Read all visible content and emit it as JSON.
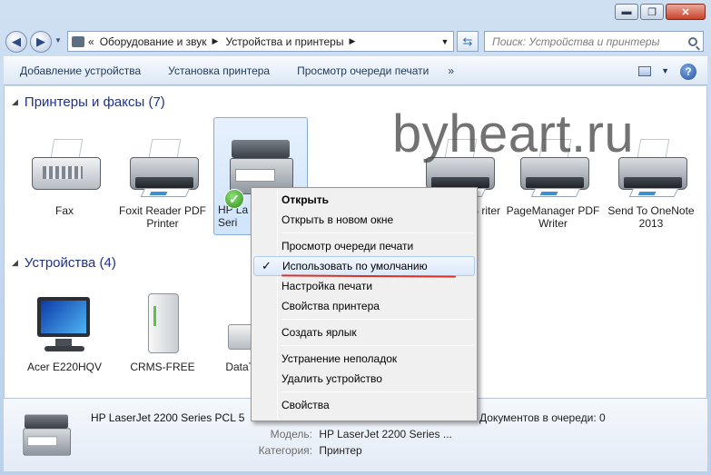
{
  "window": {
    "minimize": "▬",
    "maximize": "❐",
    "close": "✕"
  },
  "address": {
    "overflow": "«",
    "segments": [
      "Оборудование и звук",
      "Устройства и принтеры"
    ],
    "search_placeholder": "Поиск: Устройства и принтеры"
  },
  "toolbar": {
    "items": [
      "Добавление устройства",
      "Установка принтера",
      "Просмотр очереди печати"
    ],
    "more": "»"
  },
  "printers_group": {
    "title": "Принтеры и факсы (7)",
    "devices": [
      {
        "label": "Fax"
      },
      {
        "label": "Foxit Reader PDF Printer"
      },
      {
        "label": "HP La Seri"
      },
      {
        "label": "PS riter"
      },
      {
        "label": "PageManager PDF Writer"
      },
      {
        "label": "Send To OneNote 2013"
      }
    ]
  },
  "devices_group": {
    "title": "Устройства (4)",
    "devices": [
      {
        "label": "Acer E220HQV"
      },
      {
        "label": "CRMS-FREE"
      },
      {
        "label": "DataT"
      }
    ]
  },
  "context_menu": {
    "items": [
      {
        "label": "Открыть",
        "bold": true
      },
      {
        "label": "Открыть в новом окне"
      },
      {
        "label": "Просмотр очереди печати"
      },
      {
        "label": "Использовать по умолчанию",
        "checked": true
      },
      {
        "label": "Настройка печати"
      },
      {
        "label": "Свойства принтера"
      },
      {
        "label": "Создать ярлык"
      },
      {
        "label": "Устранение неполадок"
      },
      {
        "label": "Удалить устройство"
      },
      {
        "label": "Свойства"
      }
    ],
    "check_glyph": "✓"
  },
  "details": {
    "title": "HP LaserJet 2200 Series PCL 5",
    "queue_label": "Документов в очереди:",
    "queue_value": "0",
    "model_label": "Модель:",
    "model_value": "HP LaserJet 2200 Series ...",
    "category_label": "Категория:",
    "category_value": "Принтер"
  },
  "watermark": "byheart.ru",
  "colors": {
    "group_title": "#1e3287",
    "underline": "#d83327",
    "selection": "#cfe4fb"
  }
}
